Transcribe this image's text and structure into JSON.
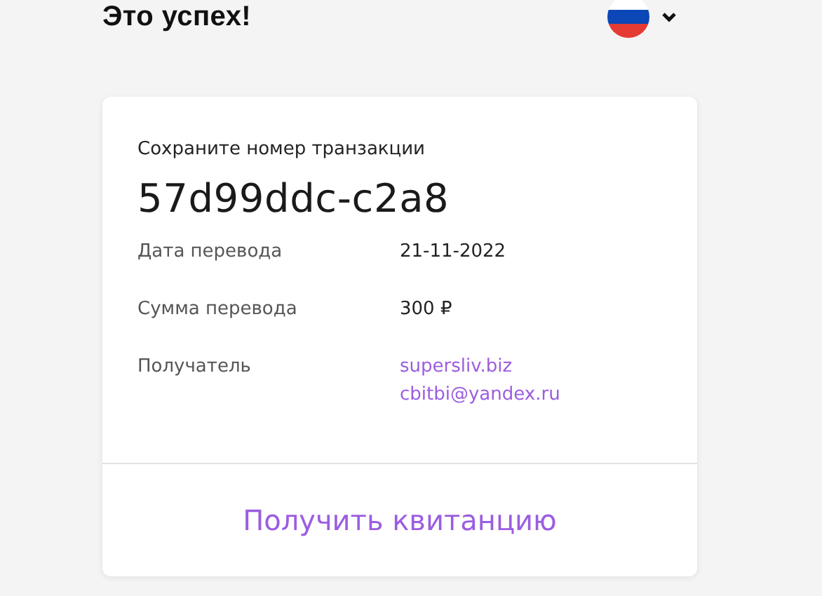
{
  "header": {
    "title": "Это успех!"
  },
  "card": {
    "hint": "Сохраните номер транзакции",
    "transaction_id": "57d99ddc-c2a8",
    "rows": [
      {
        "label": "Дата перевода",
        "kind": "text",
        "values": [
          "21-11-2022"
        ]
      },
      {
        "label": "Сумма перевода",
        "kind": "text",
        "values": [
          "300 ₽"
        ]
      },
      {
        "label": "Получатель",
        "kind": "link",
        "values": [
          "supersliv.biz",
          "cbitbi@yandex.ru"
        ]
      }
    ],
    "action": "Получить квитанцию"
  }
}
